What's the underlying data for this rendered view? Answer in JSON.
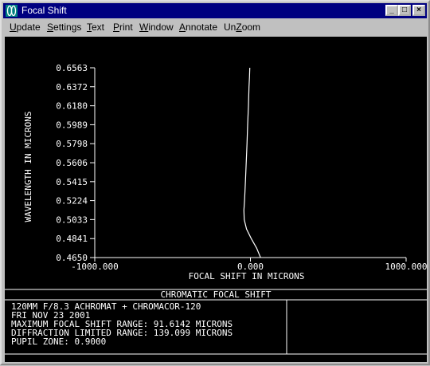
{
  "window": {
    "title": "Focal Shift",
    "minimize_glyph": "_",
    "maximize_glyph": "□",
    "close_glyph": "×"
  },
  "menu": {
    "items": [
      {
        "label": "Update",
        "accel": "U"
      },
      {
        "label": "Settings",
        "accel": "S"
      },
      {
        "label": "Text",
        "accel": "T"
      },
      {
        "label": "Print",
        "accel": "P"
      },
      {
        "label": "Window",
        "accel": "W"
      },
      {
        "label": "Annotate",
        "accel": "A"
      },
      {
        "label": "UnZoom",
        "accel": "Z"
      }
    ]
  },
  "colors": {
    "plot_background": "#000000",
    "plot_foreground": "#ffffff",
    "title_bar": "#000080",
    "chrome": "#c0c0c0"
  },
  "chart_data": {
    "type": "line",
    "title": "CHROMATIC FOCAL SHIFT",
    "xlabel": "FOCAL SHIFT IN MICRONS",
    "ylabel": "WAVELENGTH IN MICRONS",
    "xlim": [
      -1000,
      1000
    ],
    "ylim": [
      0.465,
      0.6563
    ],
    "x_ticks": [
      "-1000.000",
      "0.000",
      "1000.000"
    ],
    "y_ticks": [
      "0.4650",
      "0.4841",
      "0.5033",
      "0.5224",
      "0.5415",
      "0.5606",
      "0.5798",
      "0.5989",
      "0.6180",
      "0.6372",
      "0.6563"
    ],
    "grid": false,
    "series": [
      {
        "points": [
          {
            "x": 65,
            "y": 0.465
          },
          {
            "x": 40,
            "y": 0.4745
          },
          {
            "x": 5,
            "y": 0.4841
          },
          {
            "x": -25,
            "y": 0.4937
          },
          {
            "x": -40,
            "y": 0.5033
          },
          {
            "x": -42,
            "y": 0.5128
          },
          {
            "x": -38,
            "y": 0.5224
          },
          {
            "x": -32,
            "y": 0.5415
          },
          {
            "x": -27,
            "y": 0.5606
          },
          {
            "x": -22,
            "y": 0.5798
          },
          {
            "x": -18,
            "y": 0.5989
          },
          {
            "x": -13,
            "y": 0.618
          },
          {
            "x": -9,
            "y": 0.6372
          },
          {
            "x": -6,
            "y": 0.6468
          },
          {
            "x": -4,
            "y": 0.6563
          }
        ]
      }
    ]
  },
  "info": {
    "lines": [
      "120MM F/8.3  ACHROMAT + CHROMACOR-120",
      "FRI NOV 23 2001",
      "MAXIMUM FOCAL SHIFT RANGE: 91.6142 MICRONS",
      "DIFFRACTION LIMITED RANGE: 139.099 MICRONS",
      "PUPIL ZONE: 0.9000"
    ]
  }
}
